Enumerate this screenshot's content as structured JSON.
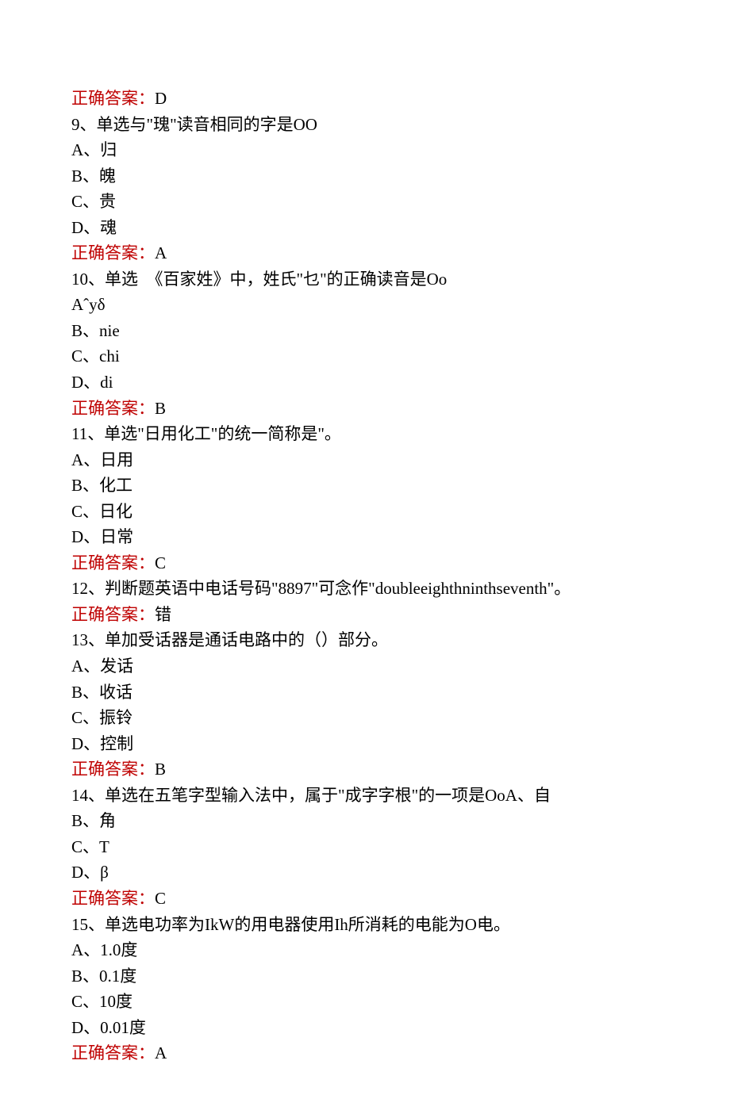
{
  "answer_label": "正确答案：",
  "blocks": [
    {
      "answer": "D"
    },
    {
      "stem": "9、单选与\"瑰\"读音相同的字是OO",
      "options": [
        "A、归",
        "B、魄",
        "C、贵",
        "D、魂"
      ],
      "answer": "A"
    },
    {
      "stem": "10、单选  《百家姓》中，姓氏\"乜\"的正确读音是Oo",
      "options": [
        "Aˆyδ",
        "B、nie",
        "C、chi",
        "D、di"
      ],
      "answer": "B"
    },
    {
      "stem": "11、单选\"日用化工\"的统一简称是\"。",
      "options": [
        "A、日用",
        "B、化工",
        "C、日化",
        "D、日常"
      ],
      "answer": "C"
    },
    {
      "stem": "12、判断题英语中电话号码\"8897\"可念作\"doubleeighthninthseventh\"。",
      "options": [],
      "answer": "错"
    },
    {
      "stem": "13、单加受话器是通话电路中的（）部分。",
      "options": [
        "A、发话",
        "B、收话",
        "C、振铃",
        "D、控制"
      ],
      "answer": "B"
    },
    {
      "stem": "14、单选在五笔字型输入法中，属于\"成字字根\"的一项是OoA、自",
      "options": [
        "B、角",
        "C、T",
        "D、β"
      ],
      "answer": "C"
    },
    {
      "stem": "15、单选电功率为IkW的用电器使用Ih所消耗的电能为O电。",
      "options": [
        "A、1.0度",
        "B、0.1度",
        "C、10度",
        "D、0.01度"
      ],
      "answer": "A"
    }
  ]
}
